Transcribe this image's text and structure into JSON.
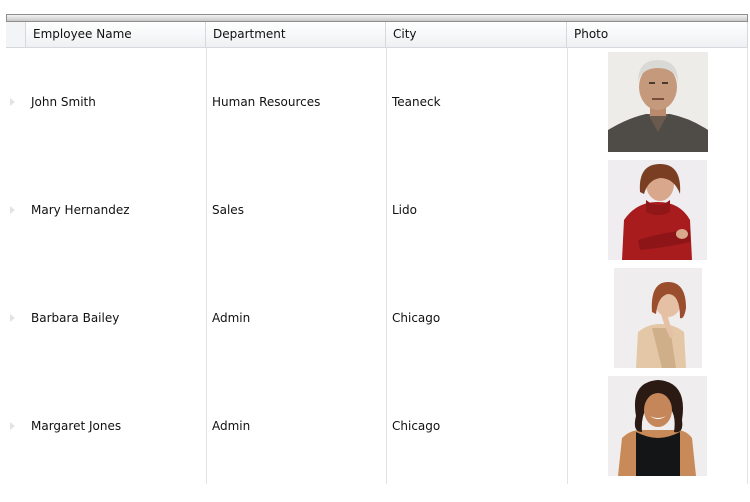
{
  "grid": {
    "columns": [
      {
        "label": "Employee Name"
      },
      {
        "label": "Department"
      },
      {
        "label": "City"
      },
      {
        "label": "Photo"
      }
    ],
    "rows": [
      {
        "name": "John Smith",
        "department": "Human Resources",
        "city": "Teaneck",
        "photo": "photo-man-gray-hair-dark-shirt"
      },
      {
        "name": "Mary Hernandez",
        "department": "Sales",
        "city": "Lido",
        "photo": "photo-woman-red-turtleneck"
      },
      {
        "name": "Barbara Bailey",
        "department": "Admin",
        "city": "Chicago",
        "photo": "photo-woman-beige-top"
      },
      {
        "name": "Margaret Jones",
        "department": "Admin",
        "city": "Chicago",
        "photo": "photo-woman-curly-hair-black-top"
      }
    ]
  }
}
